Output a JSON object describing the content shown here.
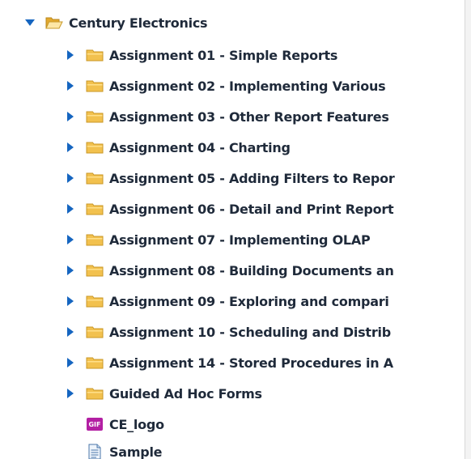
{
  "tree": {
    "root": {
      "label": "Century Electronics",
      "expanded": true,
      "icon": "folder-open-icon"
    },
    "children": [
      {
        "label": "Assignment 01 - Simple Reports",
        "icon": "folder-icon",
        "expandable": true
      },
      {
        "label": "Assignment 02 - Implementing Various",
        "icon": "folder-icon",
        "expandable": true
      },
      {
        "label": "Assignment 03 - Other Report Features",
        "icon": "folder-icon",
        "expandable": true
      },
      {
        "label": "Assignment 04 - Charting",
        "icon": "folder-icon",
        "expandable": true
      },
      {
        "label": "Assignment 05 - Adding Filters to Repor",
        "icon": "folder-icon",
        "expandable": true
      },
      {
        "label": "Assignment 06 - Detail and Print Report",
        "icon": "folder-icon",
        "expandable": true
      },
      {
        "label": "Assignment 07 - Implementing OLAP",
        "icon": "folder-icon",
        "expandable": true
      },
      {
        "label": "Assignment 08 - Building Documents an",
        "icon": "folder-icon",
        "expandable": true
      },
      {
        "label": "Assignment 09 - Exploring and compari",
        "icon": "folder-icon",
        "expandable": true
      },
      {
        "label": "Assignment 10 - Scheduling and Distrib",
        "icon": "folder-icon",
        "expandable": true
      },
      {
        "label": "Assignment 14 - Stored Procedures in A",
        "icon": "folder-icon",
        "expandable": true
      },
      {
        "label": "Guided Ad Hoc Forms",
        "icon": "folder-icon",
        "expandable": true
      },
      {
        "label": "CE_logo",
        "icon": "gif-file-icon",
        "badge": "GIF",
        "expandable": false
      },
      {
        "label": "Sample",
        "icon": "document-icon",
        "expandable": false
      }
    ]
  },
  "colors": {
    "text": "#1f2a3a",
    "arrow": "#1565c0",
    "folder": "#f2c14e",
    "gif_badge": "#b31fa3"
  }
}
